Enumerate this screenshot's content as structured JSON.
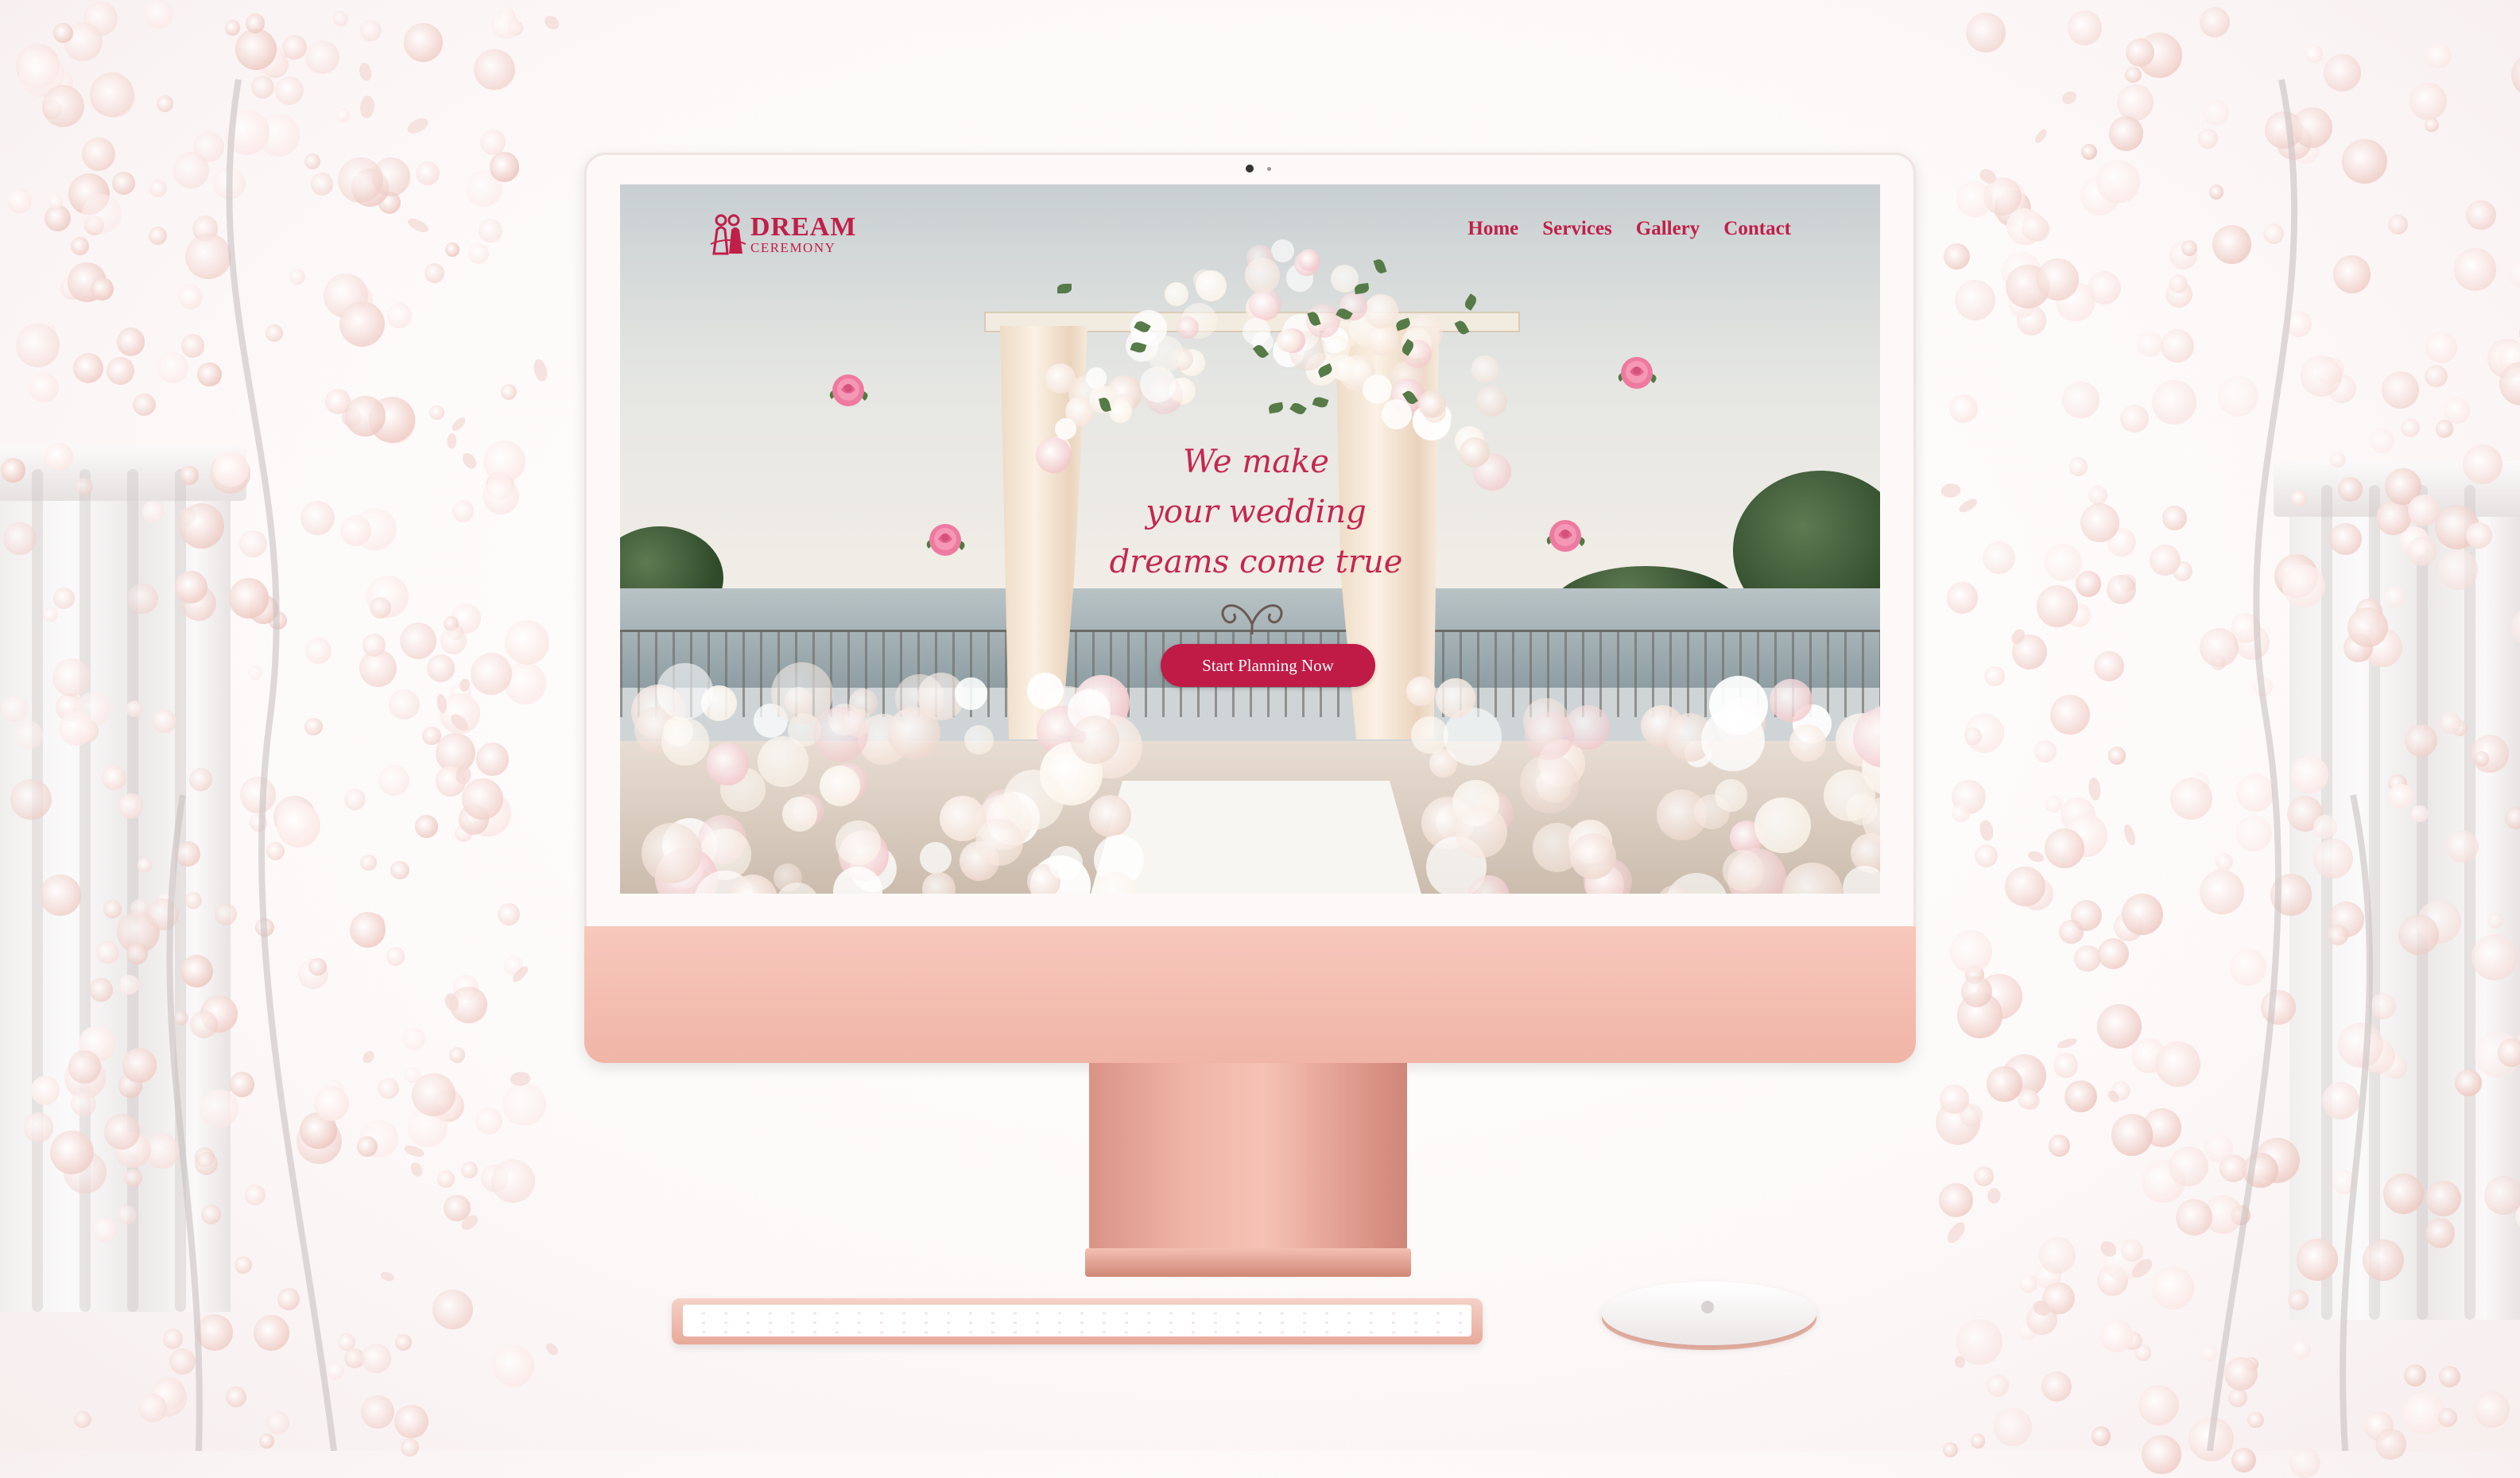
{
  "site": {
    "logo": {
      "line1": "DREAM",
      "line2": "CEREMONY"
    },
    "nav": [
      "Home",
      "Services",
      "Gallery",
      "Contact"
    ],
    "hero": {
      "title_line1": "We make",
      "title_line2": "your wedding",
      "title_line3": "dreams come true",
      "cta_label": "Start Planning Now"
    }
  },
  "colors": {
    "brand": "#c01f49",
    "button": "#bf1b46",
    "monitor_body": "#f0b5a7",
    "background": "#fdf9f9"
  },
  "icons": [
    "dream-ceremony-logo-icon",
    "pink-rose-icon",
    "swirl-ornament-icon",
    "camera-icon",
    "apple-logo-icon"
  ]
}
